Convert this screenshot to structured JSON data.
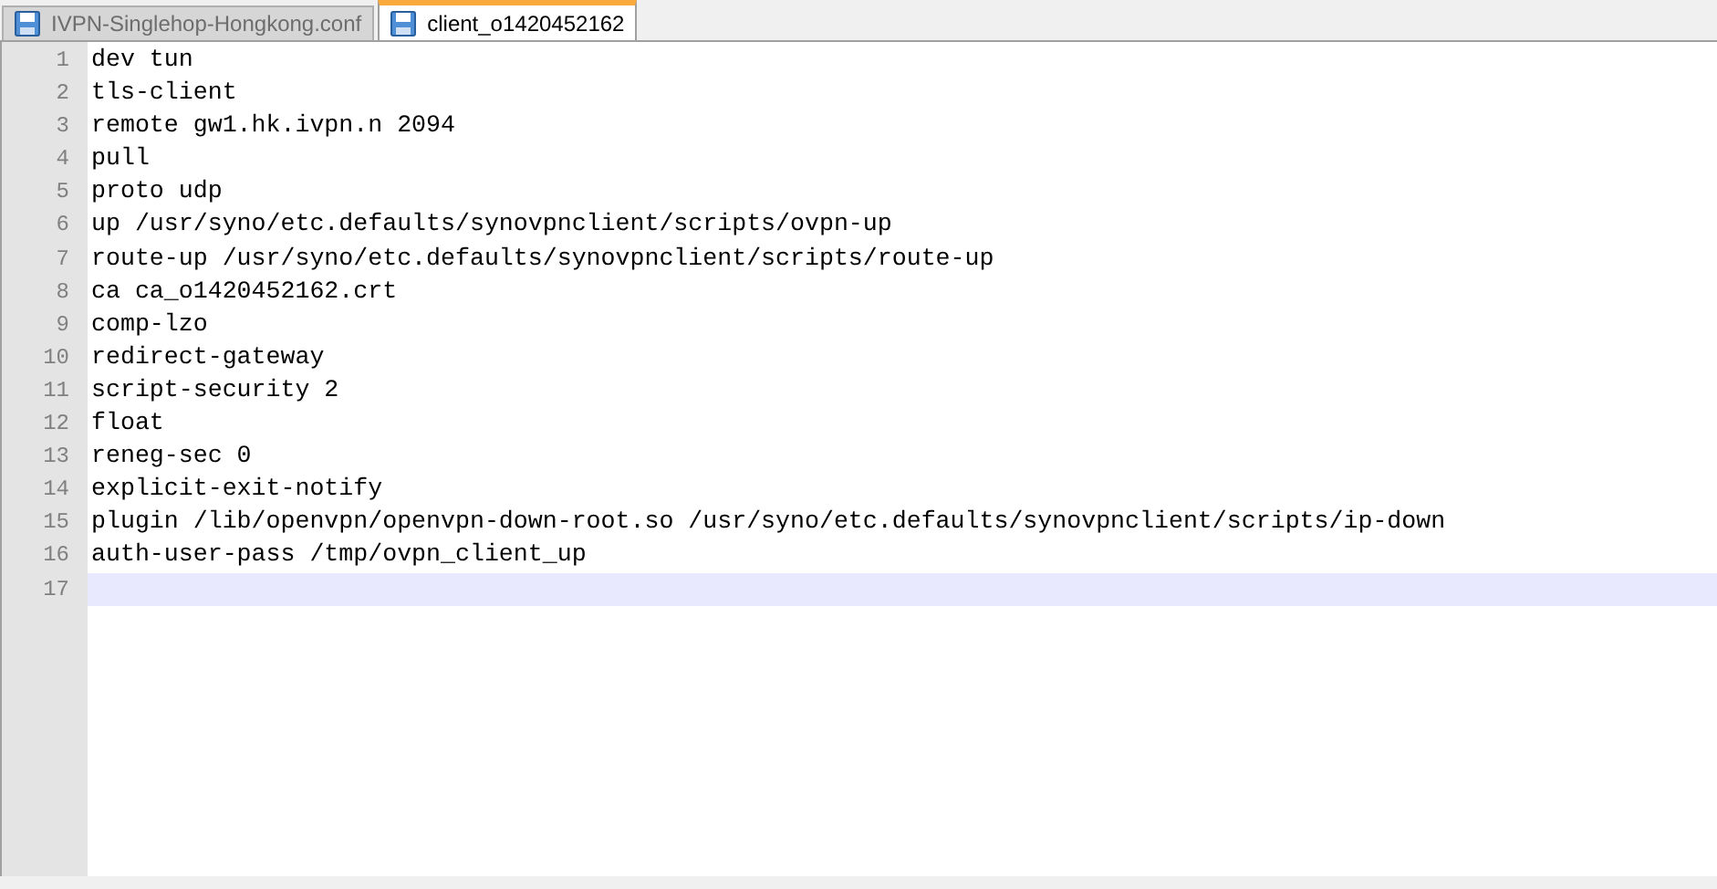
{
  "tabs": [
    {
      "label": "IVPN-Singlehop-Hongkong.conf",
      "selected": false
    },
    {
      "label": "client_o1420452162",
      "selected": true
    }
  ],
  "lines": [
    {
      "number": "1",
      "text": "dev tun",
      "current": false
    },
    {
      "number": "2",
      "text": "tls-client",
      "current": false
    },
    {
      "number": "3",
      "text": "remote gw1.hk.ivpn.n 2094",
      "current": false
    },
    {
      "number": "4",
      "text": "pull",
      "current": false
    },
    {
      "number": "5",
      "text": "proto udp",
      "current": false
    },
    {
      "number": "6",
      "text": "up /usr/syno/etc.defaults/synovpnclient/scripts/ovpn-up",
      "current": false
    },
    {
      "number": "7",
      "text": "route-up /usr/syno/etc.defaults/synovpnclient/scripts/route-up",
      "current": false
    },
    {
      "number": "8",
      "text": "ca ca_o1420452162.crt",
      "current": false
    },
    {
      "number": "9",
      "text": "comp-lzo",
      "current": false
    },
    {
      "number": "10",
      "text": "redirect-gateway",
      "current": false
    },
    {
      "number": "11",
      "text": "script-security 2",
      "current": false
    },
    {
      "number": "12",
      "text": "float",
      "current": false
    },
    {
      "number": "13",
      "text": "reneg-sec 0",
      "current": false
    },
    {
      "number": "14",
      "text": "explicit-exit-notify",
      "current": false
    },
    {
      "number": "15",
      "text": "plugin /lib/openvpn/openvpn-down-root.so /usr/syno/etc.defaults/synovpnclient/scripts/ip-down",
      "current": false
    },
    {
      "number": "16",
      "text": "auth-user-pass /tmp/ovpn_client_up",
      "current": false
    },
    {
      "number": "17",
      "current": true
    }
  ]
}
